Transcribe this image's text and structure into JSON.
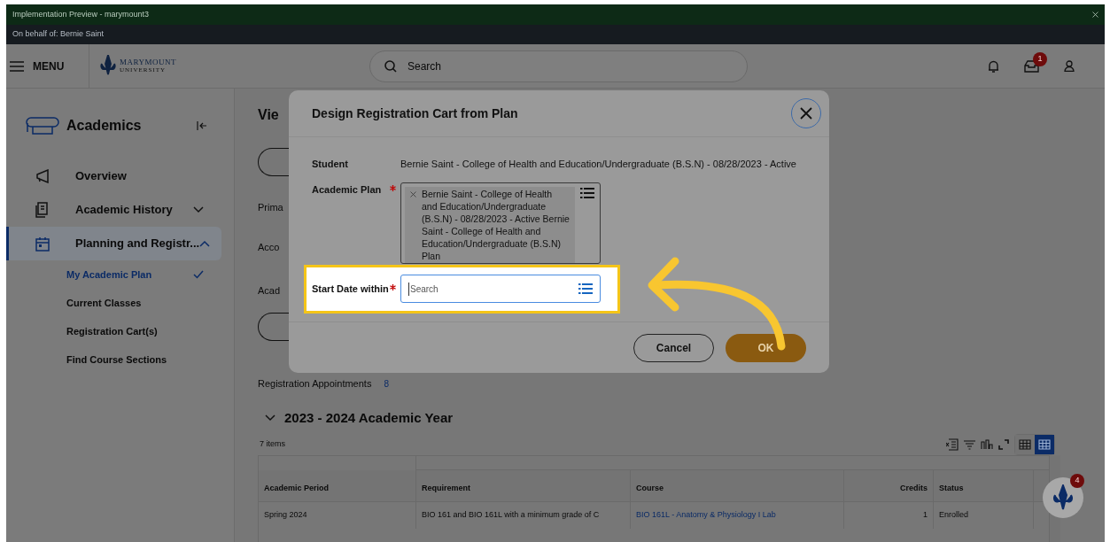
{
  "banner": {
    "title": "Implementation Preview - marymount3",
    "on_behalf": "On behalf of: Bernie Saint"
  },
  "header": {
    "menu": "MENU",
    "logo": {
      "line1": "MARYMOUNT",
      "line2": "UNIVERSITY"
    },
    "search": {
      "placeholder": "Search"
    },
    "inbox_badge": "1"
  },
  "sidebar": {
    "title": "Academics",
    "items": [
      {
        "kind": "link",
        "label": "Overview",
        "selected": false
      },
      {
        "kind": "group",
        "label": "Academic History",
        "expanded": false,
        "selected": false
      },
      {
        "kind": "group",
        "label": "Planning and Registr...",
        "expanded": true,
        "selected": true,
        "children": [
          {
            "label": "My Academic Plan",
            "selected": true
          },
          {
            "label": "Current Classes",
            "selected": false
          },
          {
            "label": "Registration Cart(s)",
            "selected": false
          },
          {
            "label": "Find Course Sections",
            "selected": false
          }
        ]
      }
    ]
  },
  "page": {
    "heading": "Vie",
    "labels": [
      "Prima",
      "Acco",
      "Acad"
    ],
    "registration_appointments": {
      "label": "Registration Appointments",
      "count": "8"
    },
    "section": {
      "title": "2023 - 2024 Academic Year",
      "expanded": true,
      "item_count": "7 items",
      "view_toggles": [
        {
          "selected": false
        },
        {
          "selected": true
        }
      ],
      "table": {
        "columns": [
          "Academic Period",
          "Requirement",
          "Course",
          "Credits",
          "Status"
        ],
        "rows": [
          {
            "period": "Spring 2024",
            "requirement": "BIO 161 and BIO 161L with a minimum grade of C",
            "course": "BIO 161L - Anatomy & Physiology I Lab",
            "credits": "1",
            "status": "Enrolled"
          }
        ]
      }
    }
  },
  "assistant_badge": "4",
  "dialog": {
    "title": "Design Registration Cart from Plan",
    "fields": [
      {
        "kind": "text",
        "label": "Student",
        "required": false,
        "value": "Bernie Saint - College of Health and Education/Undergraduate (B.S.N) - 08/28/2023 - Active"
      },
      {
        "kind": "multiselect",
        "label": "Academic Plan",
        "required": true,
        "values": [
          "Bernie Saint - College of Health and Education/Undergraduate (B.S.N) - 08/28/2023 - Active Bernie Saint - College of Health and Education/Undergraduate (B.S.N) Plan"
        ]
      },
      {
        "kind": "search",
        "label": "Start Date within",
        "required": true,
        "placeholder": "Search",
        "highlighted": true
      }
    ],
    "buttons": [
      {
        "kind": "secondary",
        "label": "Cancel"
      },
      {
        "kind": "primary",
        "label": "OK"
      }
    ]
  }
}
